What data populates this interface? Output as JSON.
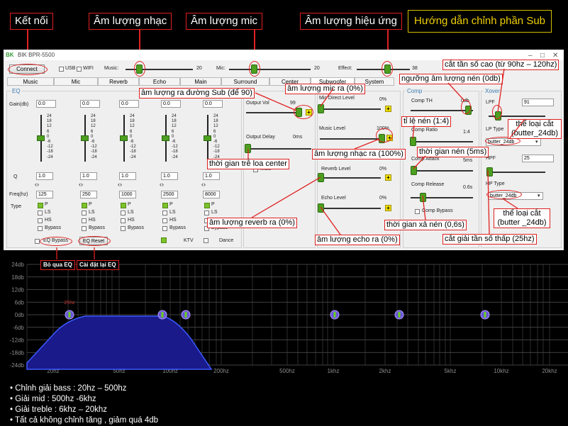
{
  "top_labels": {
    "connect": "Kết nối",
    "music": "Âm lượng nhạc",
    "mic": "Âm lượng mic",
    "effect": "Âm lượng hiệu ứng",
    "guide": "Hướng dẫn chỉnh phần Sub"
  },
  "window": {
    "title": "BIK BPR-5500",
    "connect": "Connect",
    "usb": "USB",
    "wifi": "WIFI",
    "music_lbl": "Music:",
    "music_val": "20",
    "mic_lbl": "Mic:",
    "mic_val": "20",
    "effect_lbl": "Effect:",
    "effect_val": "38"
  },
  "tabs": [
    "Music",
    "Mic",
    "Reverb",
    "Echo",
    "Main",
    "Surround",
    "Center",
    "Subwoofer",
    "System"
  ],
  "eq": {
    "title": "EQ",
    "gain_lbl": "Gain(db)",
    "q_lbl": "Q",
    "freq_lbl": "Freq(hz)",
    "type_lbl": "Type",
    "scale": [
      "24",
      "18",
      "12",
      "6",
      "0",
      "-6",
      "-12",
      "-18",
      "-24"
    ],
    "bands": [
      {
        "gain": "0.0",
        "q": "1.0",
        "freq": "125"
      },
      {
        "gain": "0.0",
        "q": "1.0",
        "freq": "250"
      },
      {
        "gain": "0.0",
        "q": "1.0",
        "freq": "1000"
      },
      {
        "gain": "0.0",
        "q": "1.0",
        "freq": "2500"
      },
      {
        "gain": "0.0",
        "q": "1.0",
        "freq": "8000"
      }
    ],
    "types": [
      "P",
      "LS",
      "HS",
      "Bypass"
    ],
    "bypass": "EQ Bypass",
    "reset": "EQ Reset",
    "ktv": "KTV",
    "dance": "Dance"
  },
  "out": {
    "vol_lbl": "Output Vol",
    "vol_val": "99",
    "delay_lbl": "Output Delay",
    "delay_val": "0ms",
    "mute": "Mute"
  },
  "mix": {
    "mic_direct": "Mic Direct Level",
    "mic_direct_val": "0%",
    "music": "Music Level",
    "music_val": "100%",
    "reverb": "Reverb Level",
    "reverb_val": "0%",
    "echo": "Echo Level",
    "echo_val": "0%"
  },
  "comp": {
    "title": "Comp",
    "th": "Comp TH",
    "th_val": "0db",
    "ratio": "Comp Ratio",
    "ratio_val": "1:4",
    "attack": "Comp Attack",
    "attack_val": "5ms",
    "release": "Comp Release",
    "release_val": "0.6s",
    "bypass": "Comp Bypass"
  },
  "xover": {
    "title": "Xover",
    "lpf": "LPF",
    "lpf_val": "91",
    "lp_type": "LP Type",
    "lp_sel": "butter_24db",
    "hpf": "HPF",
    "hpf_val": "25",
    "hp_type": "HP Type",
    "hp_sel": "butter_24db"
  },
  "annotations": {
    "sub_out": "âm lượng ra đường Sub (để 90)",
    "mic_out": "âm lượng mic ra (0%)",
    "hi_cut": "cắt tần số cao (từ 90hz – 120hz)",
    "threshold": "ngưỡng âm lượng nén (0db)",
    "ratio": "tỉ lệ nén (1:4)",
    "lp_type": "thể loại cắt (butter_24db)",
    "attack": "thời gian nén (5ms)",
    "delay": "thời gian trễ loa center",
    "music_out": "âm lượng nhạc ra (100%)",
    "reverb_out": "âm lượng reverb ra (0%)",
    "echo_out": "âm lượng echo ra (0%)",
    "release": "thời gian xả nén (0,6s)",
    "hp_type": "thể loại cắt (butter _24db)",
    "lo_cut": "cắt giải tần số thấp (25hz)",
    "bypass_eq": "Bỏ qua EQ",
    "reset_eq": "Cài đặt lại EQ"
  },
  "graph": {
    "y_labels": [
      "24db",
      "18db",
      "12db",
      "6db",
      "0db",
      "-6db",
      "-12db",
      "-18db",
      "-24db"
    ],
    "x_labels": [
      "20hz",
      "50hz",
      "100hz",
      "200hz",
      "500hz",
      "1khz",
      "2khz",
      "5khz",
      "10khz",
      "20khz"
    ],
    "marker": "25hz"
  },
  "notes": [
    "• Chỉnh giải bass : 20hz – 500hz",
    "• Giải mid : 500hz -6khz",
    "• Giải treble : 6khz – 20khz",
    "• Tất cả không chỉnh tăng , giảm quá 4db"
  ]
}
